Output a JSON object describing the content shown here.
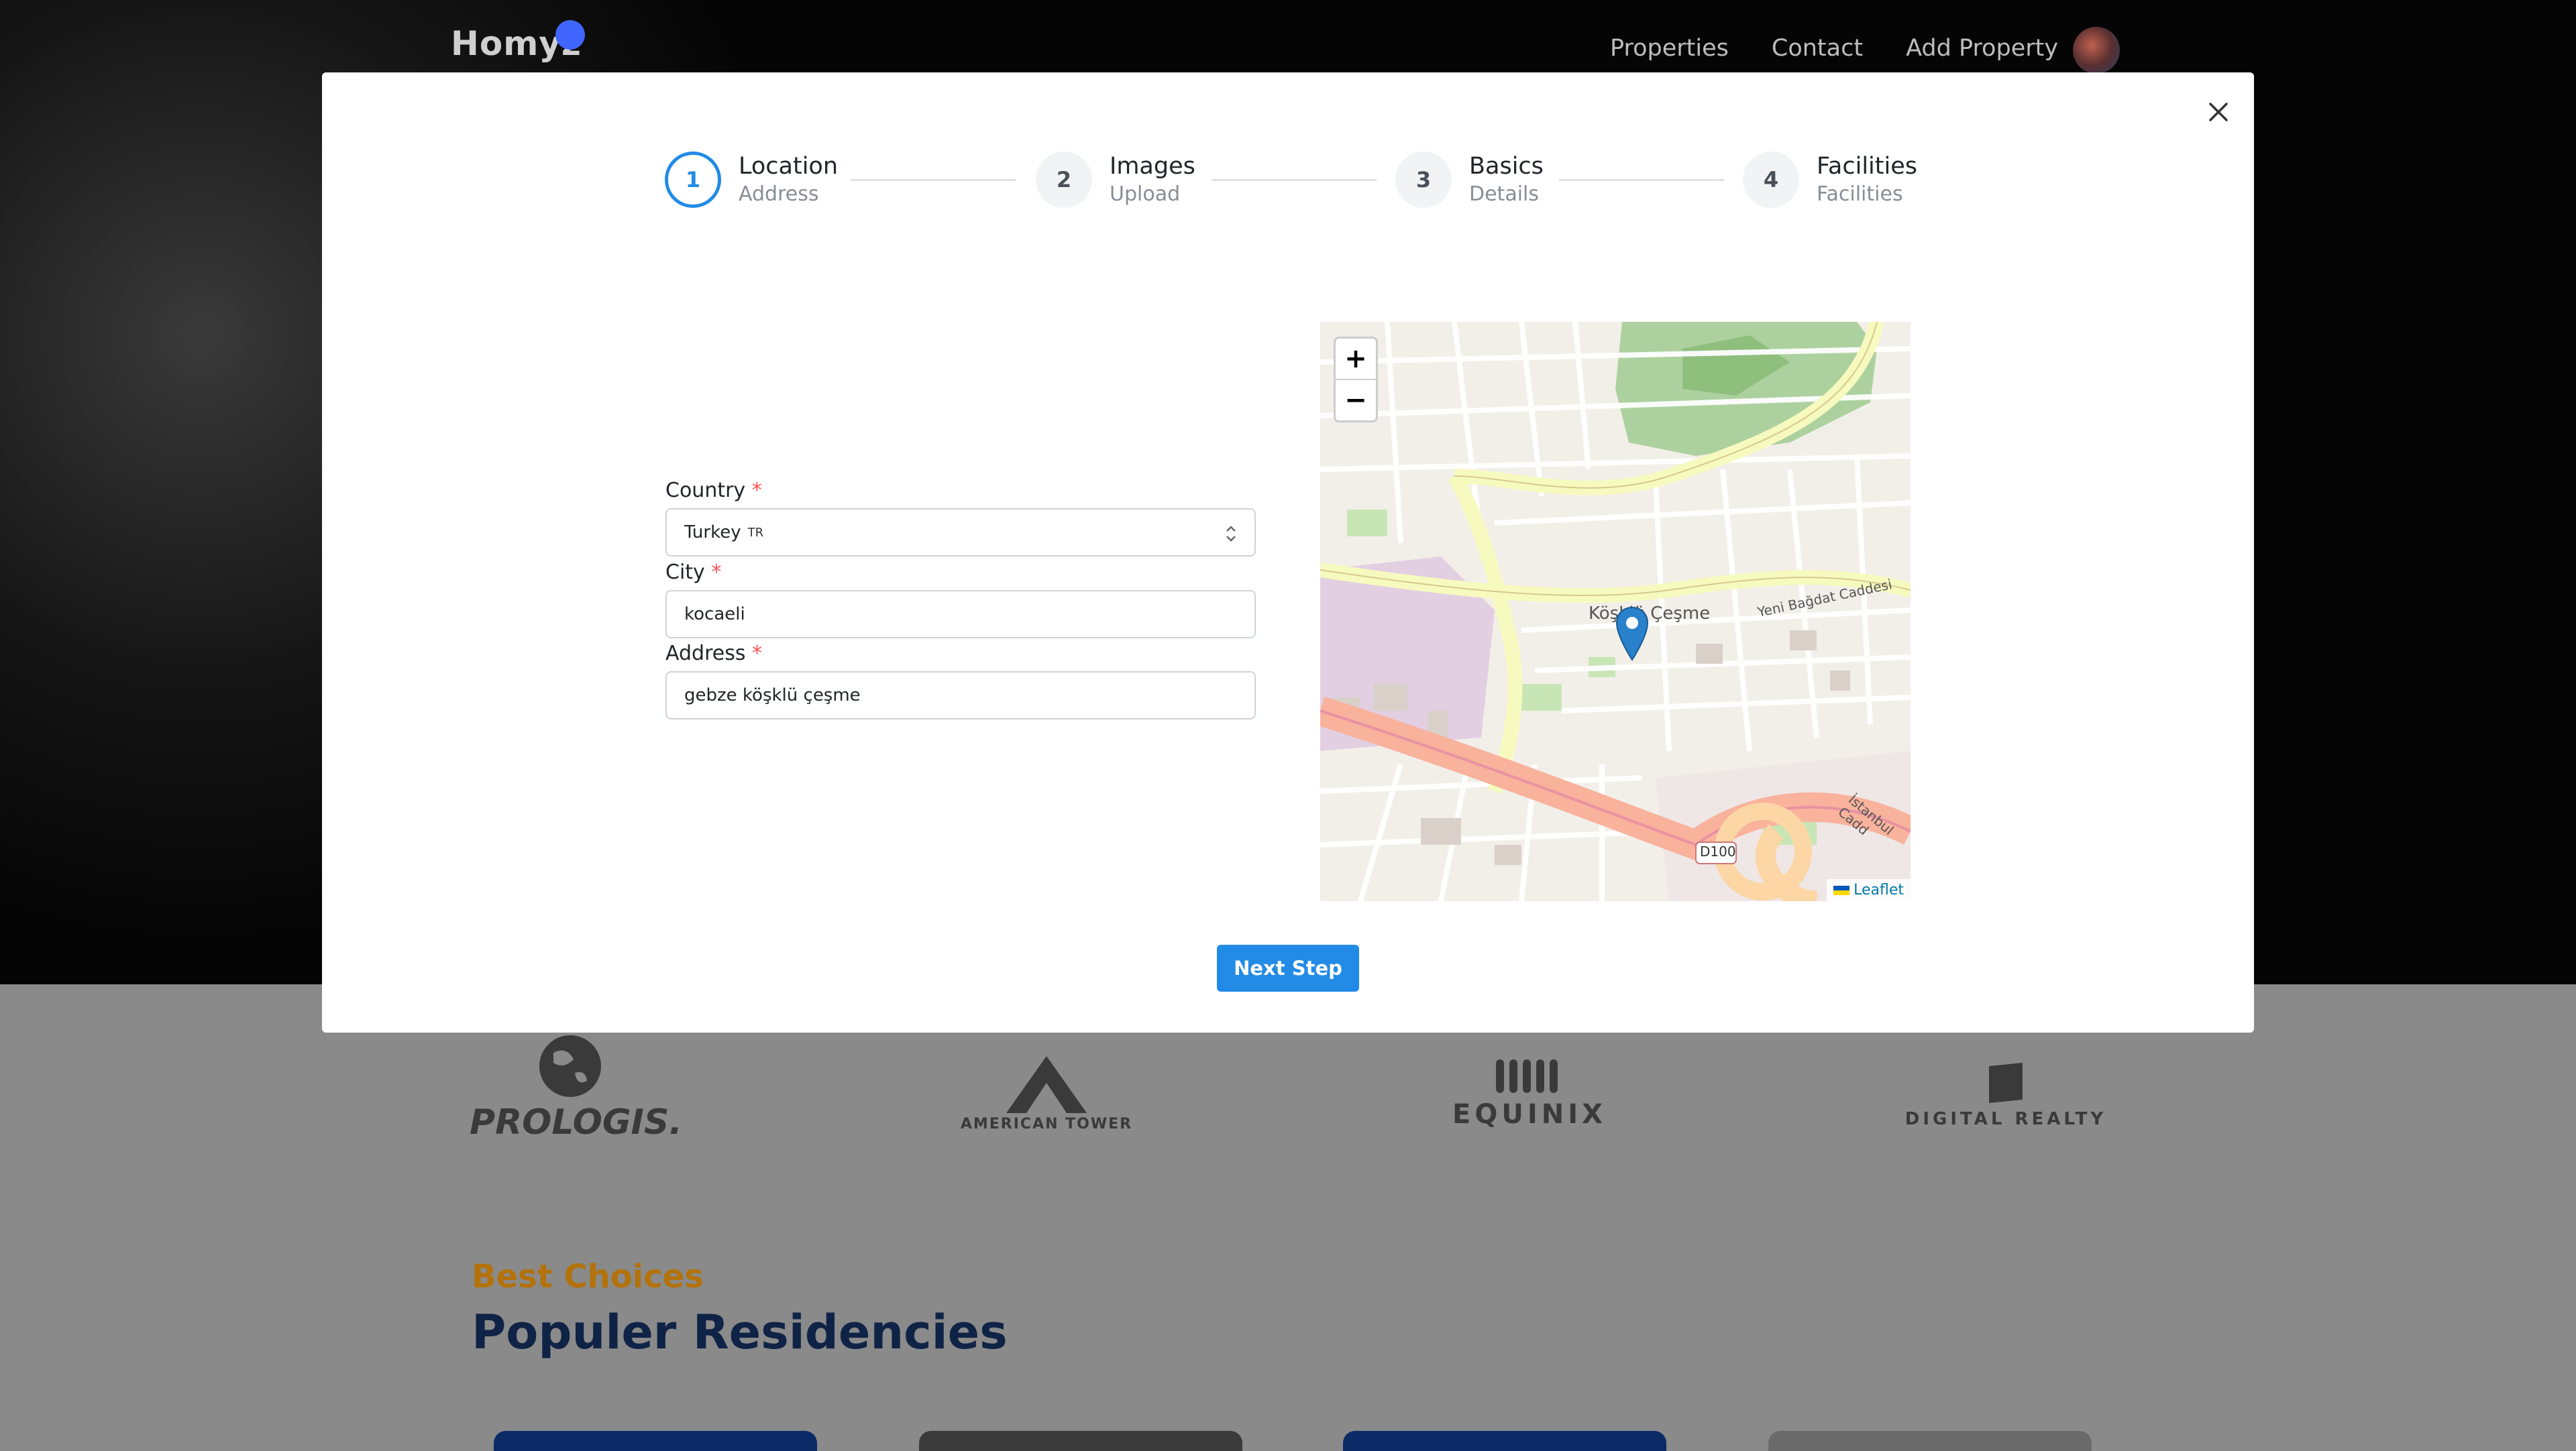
{
  "navbar": {
    "logo": "Homyz",
    "links": [
      "Properties",
      "Contact",
      "Add Property"
    ]
  },
  "partners": [
    "PROLOGIS.",
    "AMERICAN TOWER",
    "EQUINIX",
    "DIGITAL REALTY"
  ],
  "section": {
    "eyebrow": "Best Choices",
    "title": "Populer Residencies"
  },
  "steps": [
    {
      "number": "1",
      "label": "Location",
      "description": "Address",
      "active": true
    },
    {
      "number": "2",
      "label": "Images",
      "description": "Upload",
      "active": false
    },
    {
      "number": "3",
      "label": "Basics",
      "description": "Details",
      "active": false
    },
    {
      "number": "4",
      "label": "Facilities",
      "description": "Facilities",
      "active": false
    }
  ],
  "form": {
    "country": {
      "label": "Country",
      "value": "Turkey",
      "flag": "TR"
    },
    "city": {
      "label": "City",
      "value": "kocaeli"
    },
    "address": {
      "label": "Address",
      "value": "gebze köşklü çeşme"
    }
  },
  "map": {
    "zoom_in": "+",
    "zoom_out": "−",
    "labels": {
      "place": "Köşklü Çeşme",
      "street1": "Yeni Bağdat Caddesi",
      "road_badge": "D100",
      "street2": "İstanbul Cadd"
    },
    "attribution": "Leaflet"
  },
  "actions": {
    "next": "Next Step"
  },
  "colors": {
    "accent": "#228be6",
    "required": "#fa5252",
    "section_eyebrow": "#b3720a",
    "section_title": "#0f2346"
  }
}
